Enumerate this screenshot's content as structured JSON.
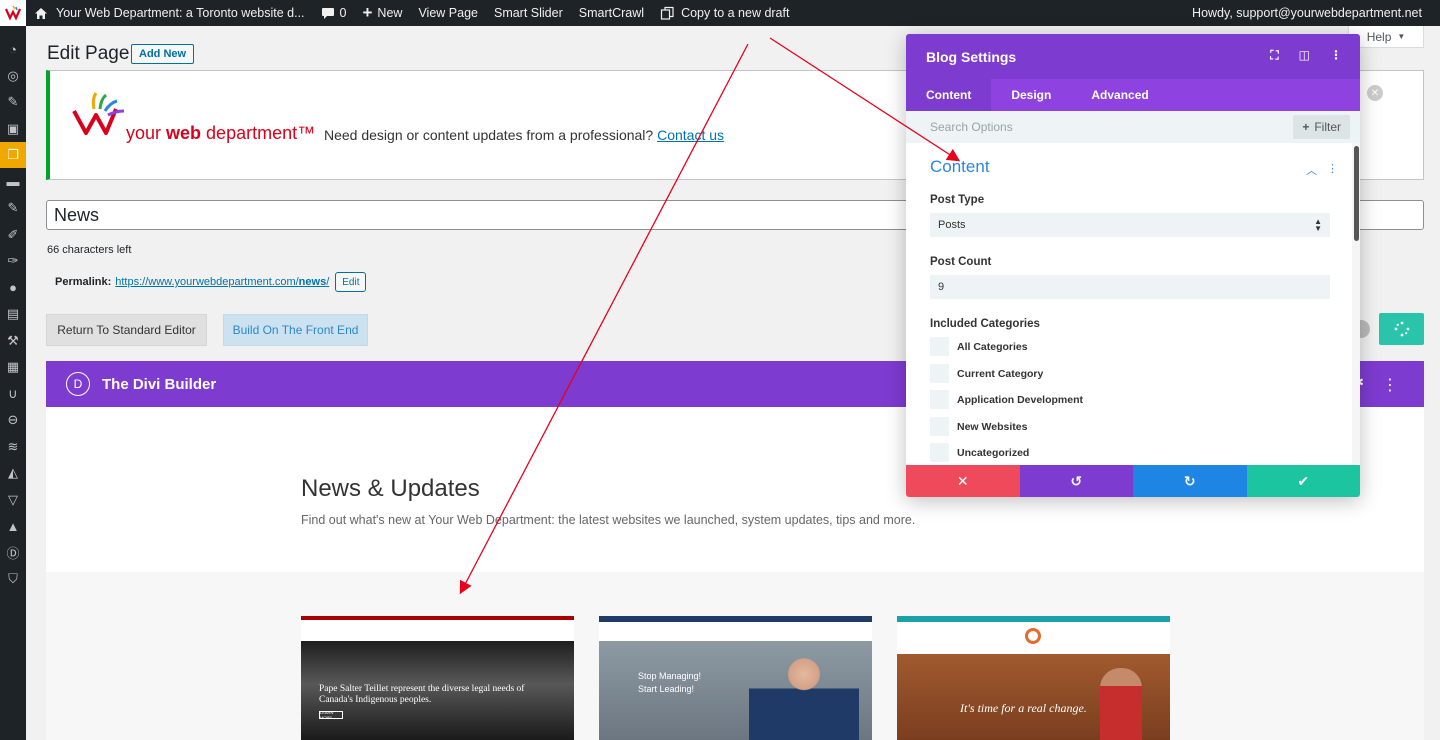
{
  "adminbar": {
    "site_name": "Your Web Department: a Toronto website d...",
    "comments_count": "0",
    "new_label": "New",
    "view_page": "View Page",
    "smart_slider": "Smart Slider",
    "smartcrawl": "SmartCrawl",
    "copy_draft": "Copy to a new draft",
    "howdy": "Howdy, support@yourwebdepartment.net"
  },
  "header": {
    "title": "Edit Page",
    "add_new": "Add New",
    "help": "Help"
  },
  "banner": {
    "brand_prefix": "your ",
    "brand_bold": "web",
    "brand_suffix": " department™",
    "message": "Need design or content updates from a professional?",
    "link": "Contact us"
  },
  "editor": {
    "title_value": "News",
    "chars_left": "66 characters left",
    "permalink_label": "Permalink:",
    "permalink_base": "https://www.yourwebdepartment.com/",
    "permalink_slug": "news",
    "permalink_end": "/",
    "edit_label": "Edit",
    "return_standard": "Return To Standard Editor",
    "build_front": "Build On The Front End"
  },
  "divi": {
    "logo_letter": "D",
    "title": "The Divi Builder"
  },
  "canvas": {
    "news_title": "News & Updates",
    "news_sub": "Find out what's new at Your Web Department: the latest websites we launched, system updates, tips and more.",
    "thumb1_text_1": "Pape Salter Teillet represent the diverse legal needs of",
    "thumb1_text_2": "Canada's Indigenous peoples.",
    "thumb1_btn": "LEARN MORE",
    "thumb2_text_1": "Stop Managing!",
    "thumb2_text_2": "Start Leading!",
    "thumb3_text": "It's time for a real change."
  },
  "modal": {
    "title": "Blog Settings",
    "tabs": [
      {
        "label": "Content"
      },
      {
        "label": "Design"
      },
      {
        "label": "Advanced"
      }
    ],
    "search_placeholder": "Search Options",
    "filter_label": "Filter",
    "section_title": "Content",
    "post_type_label": "Post Type",
    "post_type_value": "Posts",
    "post_count_label": "Post Count",
    "post_count_value": "9",
    "included_label": "Included Categories",
    "categories": [
      "All Categories",
      "Current Category",
      "Application Development",
      "New Websites",
      "Uncategorized"
    ],
    "footer_colors": [
      "#ef4a5b",
      "#7e3bd0",
      "#1f85e4",
      "#1dc4a0"
    ]
  }
}
